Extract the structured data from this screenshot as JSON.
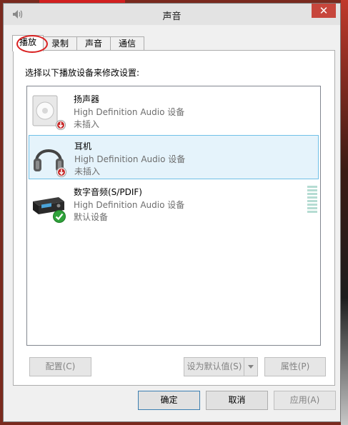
{
  "window": {
    "title": "声音",
    "close": "✕"
  },
  "tabs": [
    {
      "label": "播放",
      "active": true
    },
    {
      "label": "录制",
      "active": false
    },
    {
      "label": "声音",
      "active": false
    },
    {
      "label": "通信",
      "active": false
    }
  ],
  "instruction": "选择以下播放设备来修改设置:",
  "devices": [
    {
      "name": "扬声器",
      "driver": "High Definition Audio 设备",
      "status": "未插入",
      "icon": "speaker-icon",
      "badge": "unplugged-arrow-icon"
    },
    {
      "name": "耳机",
      "driver": "High Definition Audio 设备",
      "status": "未插入",
      "icon": "headphones-icon",
      "badge": "unplugged-arrow-icon",
      "selected": true
    },
    {
      "name": "数字音频(S/PDIF)",
      "driver": "High Definition Audio 设备",
      "status": "默认设备",
      "icon": "digital-audio-receiver-icon",
      "badge": "default-checkmark-icon"
    }
  ],
  "buttons": {
    "configure": "配置(C)",
    "set_default": "设为默认值(S)",
    "properties": "属性(P)",
    "ok": "确定",
    "cancel": "取消",
    "apply": "应用(A)"
  },
  "colors": {
    "selection_bg": "#e5f3fb",
    "selection_border": "#70c0e7",
    "close_button": "#c7463c",
    "annotation_red": "#d92020"
  }
}
